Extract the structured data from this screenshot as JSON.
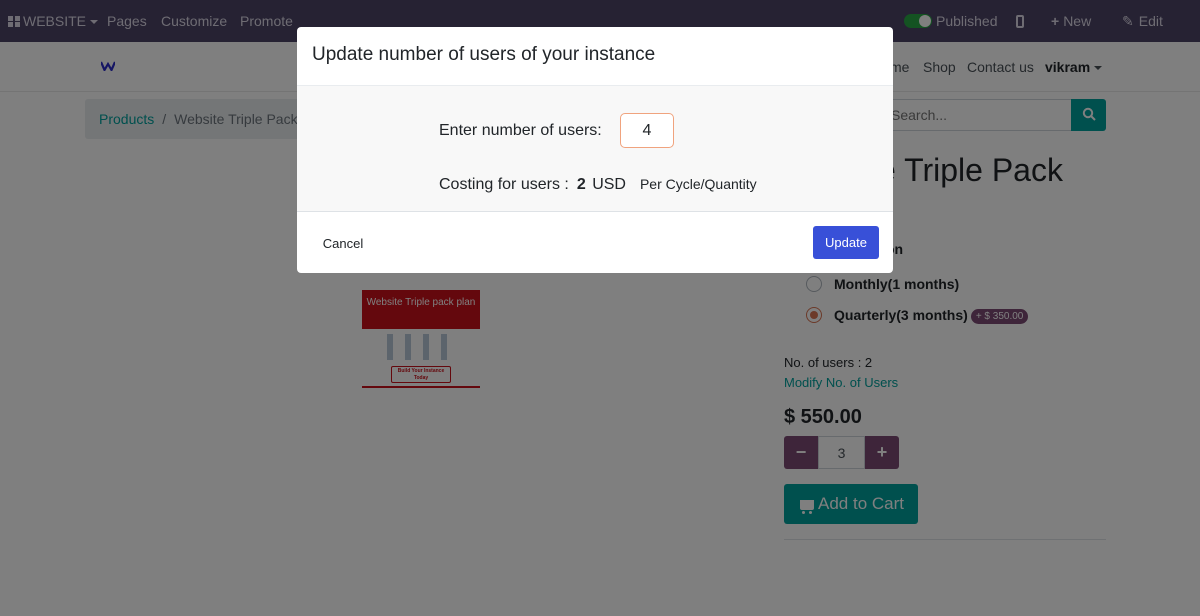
{
  "topbar": {
    "website_label": "WEBSITE",
    "pages_label": "Pages",
    "customize_label": "Customize",
    "promote_label": "Promote",
    "published_label": "Published",
    "new_label": "New",
    "edit_label": "Edit",
    "background_color": "#4c4467"
  },
  "nav": {
    "home_label": "me",
    "shop_label": "Shop",
    "contact_label": "Contact us",
    "user_label": "vikram"
  },
  "breadcrumb": {
    "products_label": "Products",
    "separator": "/",
    "current_label": "Website Triple Pack Pl"
  },
  "search": {
    "placeholder": "Search..."
  },
  "product": {
    "title": "e Triple Pack",
    "subscription_label_partial": "on",
    "options": [
      {
        "label": "Monthly(1 months)",
        "selected": false
      },
      {
        "label": "Quarterly(3 months)",
        "selected": true,
        "badge": "+ $ 350.00"
      }
    ],
    "users_text": "No. of users : 2",
    "modify_link": "Modify No. of Users",
    "price": "$ 550.00",
    "quantity": "3",
    "minus_label": "−",
    "plus_label": "+",
    "add_to_cart_label": "Add to Cart",
    "image": {
      "header_text": "Website Triple pack plan",
      "cta_text": "Build Your Instance Today"
    },
    "accent_color": "#00a09d",
    "secondary_color": "#7c4a74"
  },
  "modal": {
    "title": "Update number of users of your instance",
    "enter_label": "Enter number of users:",
    "users_value": "4",
    "cost_label": "Costing for users :",
    "cost_amount": "2",
    "cost_currency": "USD",
    "cost_per": "Per Cycle/Quantity",
    "cancel_label": "Cancel",
    "update_label": "Update",
    "update_color": "#3850d8"
  }
}
